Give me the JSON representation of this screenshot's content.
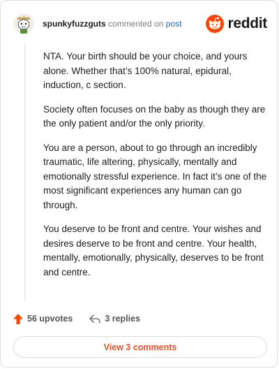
{
  "comment": {
    "username": "spunkyfuzzguts",
    "commented_text": "commented on",
    "post_link": "post",
    "brand": "reddit",
    "paragraphs": [
      "NTA. Your birth should be your choice, and yours alone. Whether that’s 100% natural, epidural, induction, c section.",
      "Society often focuses on the baby as though they are the only patient and/or the only priority.",
      "You are a person, about to go through an incredibly traumatic, life altering, physically, mentally and emotionally stressful experience. In fact it’s one of the most significant experiences any human can go through.",
      "You deserve to be front and centre. Your wishes and desires deserve to be front and centre. Your health, mentally, emotionally, physically, deserves to be front and centre."
    ],
    "upvotes_label": "56 upvotes",
    "replies_label": "3 replies",
    "view_comments_label": "View 3 comments"
  },
  "colors": {
    "upvote": "#ff4500",
    "reddit_orange": "#ff4500",
    "link": "#2d5fc6",
    "view_button_text": "#e5532b"
  },
  "icons": {
    "avatar": "snoo-avatar-icon",
    "logo": "reddit-snoo-icon",
    "upvote": "upvote-arrow-icon",
    "reply": "reply-arrow-icon"
  }
}
